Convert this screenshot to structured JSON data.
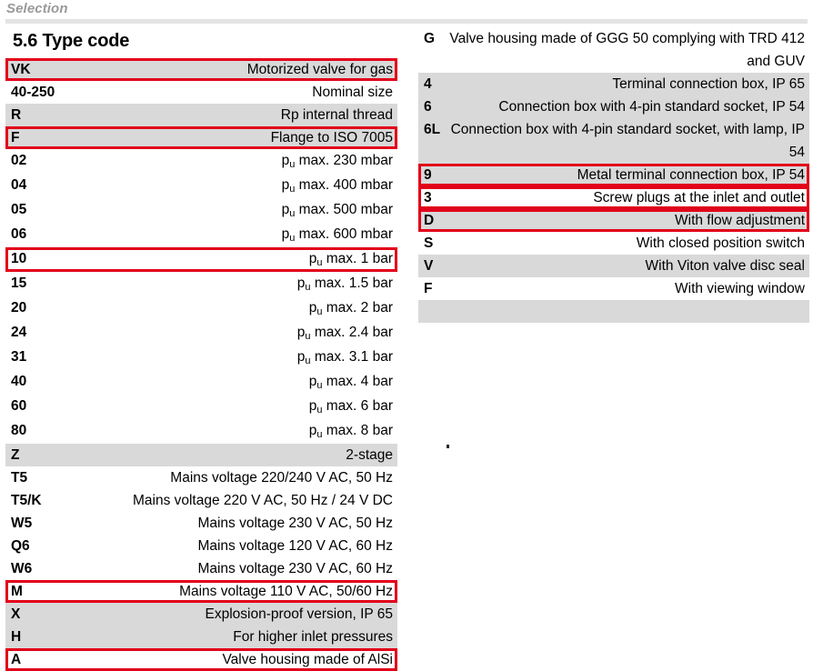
{
  "header": {
    "running_title": "Selection"
  },
  "heading": {
    "number": "5.6",
    "title": "Type code",
    "full": "5.6 Type code"
  },
  "colors": {
    "row_shade": "#d9d9d9",
    "highlight_border": "#e2001a",
    "header_text": "#9a9a9a",
    "header_rule": "#e3e3e3"
  },
  "left_table": {
    "rows": [
      {
        "code": "VK",
        "desc": "Motorized valve for gas",
        "shaded": true,
        "highlight": true
      },
      {
        "code": "40-250",
        "desc": "Nominal size",
        "shaded": false,
        "highlight": false
      },
      {
        "code": "R",
        "desc": "Rp internal thread",
        "shaded": true,
        "highlight": false
      },
      {
        "code": "F",
        "desc": "Flange to ISO 7005",
        "shaded": true,
        "highlight": true
      },
      {
        "code": "02",
        "desc": "p<sub>u</sub> max. 230 mbar",
        "desc_text": "pu max. 230 mbar",
        "shaded": false,
        "highlight": false,
        "html": true
      },
      {
        "code": "04",
        "desc": "p<sub>u</sub> max. 400 mbar",
        "desc_text": "pu max. 400 mbar",
        "shaded": false,
        "highlight": false,
        "html": true
      },
      {
        "code": "05",
        "desc": "p<sub>u</sub> max. 500 mbar",
        "desc_text": "pu max. 500 mbar",
        "shaded": false,
        "highlight": false,
        "html": true
      },
      {
        "code": "06",
        "desc": "p<sub>u</sub> max. 600 mbar",
        "desc_text": "pu max. 600 mbar",
        "shaded": false,
        "highlight": false,
        "html": true
      },
      {
        "code": "10",
        "desc": "p<sub>u</sub> max. 1 bar",
        "desc_text": "pu max. 1 bar",
        "shaded": false,
        "highlight": true,
        "html": true
      },
      {
        "code": "15",
        "desc": "p<sub>u</sub> max. 1.5 bar",
        "desc_text": "pu max. 1.5 bar",
        "shaded": false,
        "highlight": false,
        "html": true
      },
      {
        "code": "20",
        "desc": "p<sub>u</sub> max. 2 bar",
        "desc_text": "pu max. 2 bar",
        "shaded": false,
        "highlight": false,
        "html": true
      },
      {
        "code": "24",
        "desc": "p<sub>u</sub> max. 2.4 bar",
        "desc_text": "pu max. 2.4 bar",
        "shaded": false,
        "highlight": false,
        "html": true
      },
      {
        "code": "31",
        "desc": "p<sub>u</sub> max. 3.1 bar",
        "desc_text": "pu max. 3.1 bar",
        "shaded": false,
        "highlight": false,
        "html": true
      },
      {
        "code": "40",
        "desc": "p<sub>u</sub> max. 4 bar",
        "desc_text": "pu max. 4 bar",
        "shaded": false,
        "highlight": false,
        "html": true
      },
      {
        "code": "60",
        "desc": "p<sub>u</sub> max. 6 bar",
        "desc_text": "pu max. 6 bar",
        "shaded": false,
        "highlight": false,
        "html": true
      },
      {
        "code": "80",
        "desc": "p<sub>u</sub> max. 8 bar",
        "desc_text": "pu max. 8 bar",
        "shaded": false,
        "highlight": false,
        "html": true
      },
      {
        "code": "Z",
        "desc": "2-stage",
        "shaded": true,
        "highlight": false
      },
      {
        "code": "T5",
        "desc": "Mains voltage 220/240 V AC, 50 Hz",
        "shaded": false,
        "highlight": false
      },
      {
        "code": "T5/K",
        "desc": "Mains voltage 220 V AC, 50 Hz / 24 V DC",
        "shaded": false,
        "highlight": false
      },
      {
        "code": "W5",
        "desc": "Mains voltage 230 V AC, 50 Hz",
        "shaded": false,
        "highlight": false
      },
      {
        "code": "Q6",
        "desc": "Mains voltage 120 V AC, 60 Hz",
        "shaded": false,
        "highlight": false
      },
      {
        "code": "W6",
        "desc": "Mains voltage 230 V AC, 60 Hz",
        "shaded": false,
        "highlight": false
      },
      {
        "code": "M",
        "desc": "Mains voltage 110 V AC, 50/60 Hz",
        "shaded": false,
        "highlight": true
      },
      {
        "code": "X",
        "desc": "Explosion-proof version, IP 65",
        "shaded": true,
        "highlight": false
      },
      {
        "code": "H",
        "desc": "For higher inlet pressures",
        "shaded": true,
        "highlight": false
      },
      {
        "code": "A",
        "desc": "Valve housing made of AlSi",
        "shaded": false,
        "highlight": true
      }
    ]
  },
  "right_table": {
    "rows": [
      {
        "code": "G",
        "desc": "Valve housing made of GGG 50 complying with TRD 412 and GUV",
        "shaded": false,
        "highlight": false,
        "two_line": true
      },
      {
        "code": "4",
        "desc": "Terminal connection box, IP 65",
        "shaded": true,
        "highlight": false
      },
      {
        "code": "6",
        "desc": "Connection box with 4-pin standard socket, IP 54",
        "shaded": true,
        "highlight": false
      },
      {
        "code": "6L",
        "desc": "Connection box with 4-pin standard socket, with lamp, IP 54",
        "shaded": true,
        "highlight": false,
        "two_line": true
      },
      {
        "code": "9",
        "desc": "Metal terminal connection box, IP 54",
        "shaded": true,
        "highlight": true
      },
      {
        "code": "3",
        "desc": "Screw plugs at the inlet and outlet",
        "shaded": false,
        "highlight": true
      },
      {
        "code": "D",
        "desc": "With flow adjustment",
        "shaded": true,
        "highlight": true
      },
      {
        "code": "S",
        "desc": "With closed position switch",
        "shaded": false,
        "highlight": false
      },
      {
        "code": "V",
        "desc": "With Viton valve disc seal",
        "shaded": true,
        "highlight": false
      },
      {
        "code": "F",
        "desc": "With viewing window",
        "shaded": false,
        "highlight": false
      },
      {
        "code": "",
        "desc": "",
        "shaded": true,
        "highlight": false
      }
    ]
  }
}
